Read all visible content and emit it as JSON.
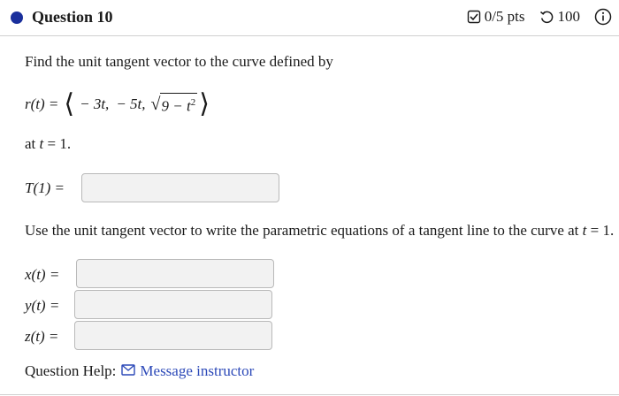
{
  "header": {
    "question_title": "Question 10",
    "score": "0/5 pts",
    "attempts": "100"
  },
  "problem": {
    "intro": "Find the unit tangent vector to the curve defined by",
    "r_lhs": "r(t) =",
    "comp1": "− 3t,",
    "comp2": "− 5t,",
    "sqrt_content": "9 − t",
    "sqrt_exp": "2",
    "at_prefix": "at",
    "at_var": "t",
    "at_eq": "= 1.",
    "T_label": "T(1) =",
    "instruction_pre": "Use the unit tangent vector to write the parametric equations of a tangent line to the curve at",
    "instruction_var": "t",
    "instruction_post": "= 1.",
    "x_label": "x(t) =",
    "y_label": "y(t) =",
    "z_label": "z(t) ="
  },
  "help": {
    "label": "Question Help:",
    "message_link": "Message instructor"
  }
}
